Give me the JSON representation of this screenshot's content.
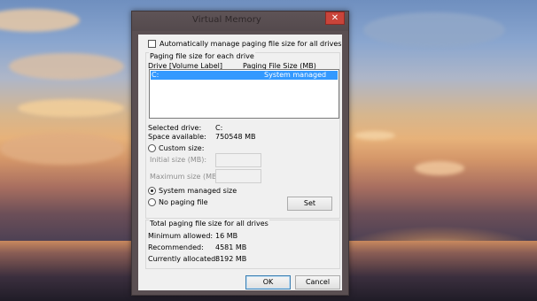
{
  "window": {
    "title": "Virtual Memory",
    "close_label": "✕"
  },
  "auto_manage": {
    "label": "Automatically manage paging file size for all drives",
    "checked": false
  },
  "per_drive": {
    "group_label": "Paging file size for each drive",
    "col_drive": "Drive  [Volume Label]",
    "col_size": "Paging File Size (MB)",
    "rows": [
      {
        "drive": "C:",
        "size": "System managed",
        "selected": true
      }
    ]
  },
  "selected_drive": {
    "label": "Selected drive:",
    "value": "C:"
  },
  "space_available": {
    "label": "Space available:",
    "value": "750548 MB"
  },
  "size_options": {
    "custom_label": "Custom size:",
    "initial_label": "Initial size (MB):",
    "initial_value": "",
    "maximum_label": "Maximum size (MB):",
    "maximum_value": "",
    "system_managed_label": "System managed size",
    "no_paging_label": "No paging file",
    "selected": "system_managed",
    "set_label": "Set"
  },
  "totals": {
    "group_label": "Total paging file size for all drives",
    "min_label": "Minimum allowed:",
    "min_value": "16 MB",
    "rec_label": "Recommended:",
    "rec_value": "4581 MB",
    "cur_label": "Currently allocated:",
    "cur_value": "8192 MB"
  },
  "footer": {
    "ok_label": "OK",
    "cancel_label": "Cancel"
  },
  "colors": {
    "selection": "#3399ff",
    "close": "#c9443a",
    "titlebar": "#5a4f52"
  }
}
